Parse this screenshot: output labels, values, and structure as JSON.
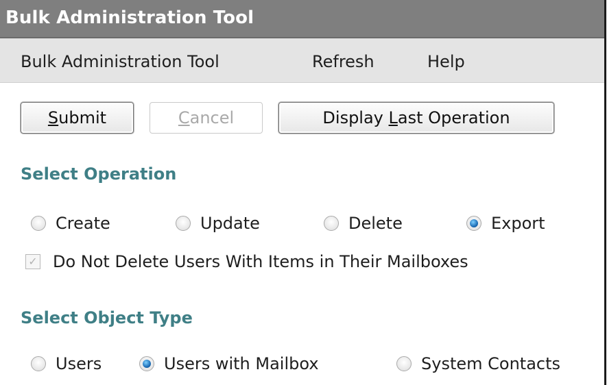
{
  "window": {
    "title": "Bulk Administration Tool"
  },
  "menu": {
    "items": [
      "Bulk Administration Tool",
      "Refresh",
      "Help"
    ]
  },
  "toolbar": {
    "submit": {
      "accel": "S",
      "rest": "ubmit",
      "enabled": true
    },
    "cancel": {
      "accel": "C",
      "rest": "ancel",
      "enabled": false
    },
    "display_last": {
      "before": "Display ",
      "accel": "L",
      "rest": "ast Operation",
      "enabled": true
    }
  },
  "select_operation": {
    "heading": "Select Operation",
    "options": [
      {
        "label": "Create",
        "checked": false
      },
      {
        "label": "Update",
        "checked": false
      },
      {
        "label": "Delete",
        "checked": false
      },
      {
        "label": "Export",
        "checked": true
      }
    ],
    "checkbox": {
      "label": "Do Not Delete Users With Items in Their Mailboxes",
      "checked": true,
      "enabled": false
    }
  },
  "select_object_type": {
    "heading": "Select Object Type",
    "options": [
      {
        "label": "Users",
        "checked": false
      },
      {
        "label": "Users with Mailbox",
        "checked": true
      },
      {
        "label": "System Contacts",
        "checked": false
      }
    ]
  },
  "colors": {
    "titlebar_bg": "#7f7f7f",
    "menubar_bg": "#e4e4e4",
    "heading_teal": "#3f7f86",
    "radio_selected": "#1e6fb8"
  }
}
